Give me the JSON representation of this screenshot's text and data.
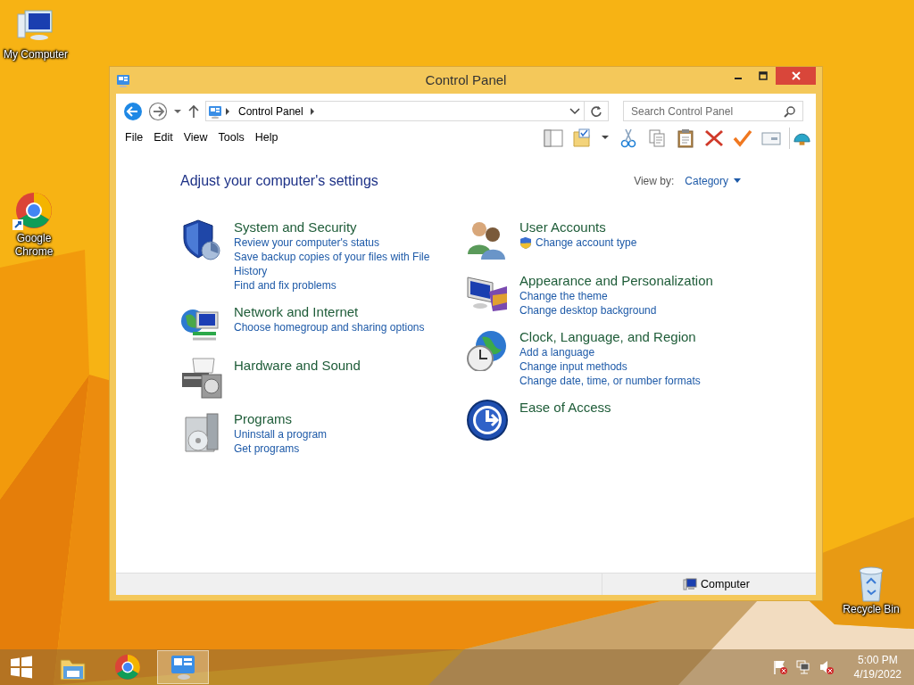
{
  "desktop_icons": [
    {
      "label": "My Computer"
    },
    {
      "label": "Google Chrome"
    },
    {
      "label": "Recycle Bin"
    }
  ],
  "window": {
    "title": "Control Panel"
  },
  "address_bar": {
    "path": "Control Panel"
  },
  "search": {
    "placeholder": "Search Control Panel"
  },
  "menu": [
    "File",
    "Edit",
    "View",
    "Tools",
    "Help"
  ],
  "heading": "Adjust your computer's settings",
  "view_by": {
    "label": "View by:",
    "value": "Category"
  },
  "columns": [
    [
      {
        "title": "System and Security",
        "links": [
          {
            "text": "Review your computer's status",
            "shield": false
          },
          {
            "text": "Save backup copies of your files with File History",
            "shield": false
          },
          {
            "text": "Find and fix problems",
            "shield": false
          }
        ]
      },
      {
        "title": "Network and Internet",
        "links": [
          {
            "text": "Choose homegroup and sharing options",
            "shield": false
          }
        ]
      },
      {
        "title": "Hardware and Sound"
      },
      {
        "title": "Programs",
        "links": [
          {
            "text": "Uninstall a program",
            "shield": false
          },
          {
            "text": "Get programs",
            "shield": false
          }
        ]
      }
    ],
    [
      {
        "title": "User Accounts",
        "links": [
          {
            "text": "Change account type",
            "shield": true
          }
        ]
      },
      {
        "title": "Appearance and Personalization",
        "links": [
          {
            "text": "Change the theme",
            "shield": false
          },
          {
            "text": "Change desktop background",
            "shield": false
          }
        ]
      },
      {
        "title": "Clock, Language, and Region",
        "links": [
          {
            "text": "Add a language",
            "shield": false
          },
          {
            "text": "Change input methods",
            "shield": false
          },
          {
            "text": "Change date, time, or number formats",
            "shield": false
          }
        ]
      },
      {
        "title": "Ease of Access"
      }
    ]
  ],
  "status_bar": {
    "location": "Computer"
  },
  "taskbar": {
    "apps": [
      {
        "selected": false
      },
      {
        "selected": false
      },
      {
        "selected": true
      }
    ],
    "time": "5:00 PM",
    "date": "4/19/2022"
  }
}
